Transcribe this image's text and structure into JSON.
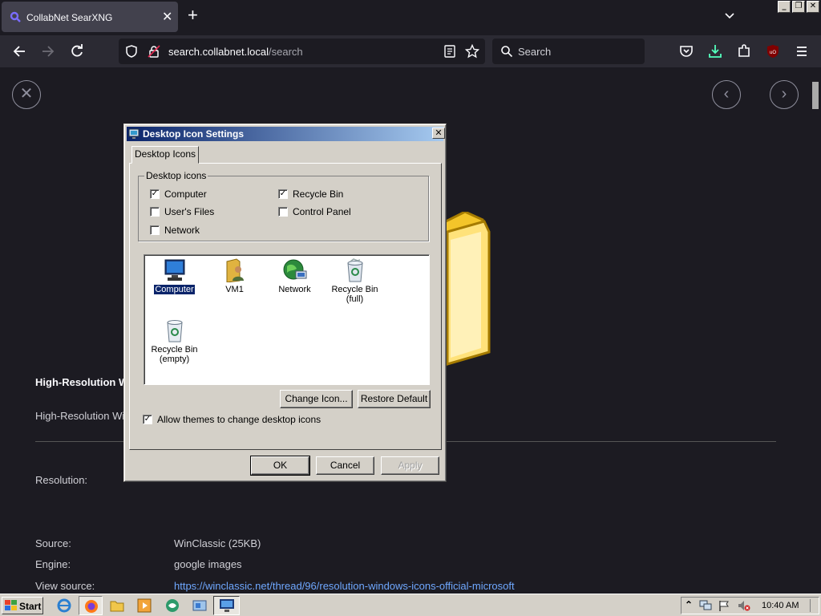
{
  "browser": {
    "tab_title": "CollabNet SearXNG",
    "url_domain": "search.collabnet.local",
    "url_path": "/search",
    "search_placeholder": "Search",
    "window_buttons": [
      "_",
      "❐",
      "✕"
    ]
  },
  "page": {
    "result_title": "High-Resolution W",
    "result_desc": "High-Resolution Wi",
    "fields": [
      {
        "key": "Resolution:",
        "value": ""
      },
      {
        "key": "Source:",
        "value": "WinClassic (25KB)"
      },
      {
        "key": "Engine:",
        "value": "google images"
      },
      {
        "key": "View source:",
        "value": "https://winclassic.net/thread/96/resolution-windows-icons-official-microsoft"
      }
    ]
  },
  "dialog": {
    "title": "Desktop Icon Settings",
    "tab": "Desktop Icons",
    "group_label": "Desktop icons",
    "checkboxes": [
      {
        "label": "Computer",
        "checked": true
      },
      {
        "label": "User's Files",
        "checked": false
      },
      {
        "label": "Network",
        "checked": false
      },
      {
        "label": "Recycle Bin",
        "checked": true
      },
      {
        "label": "Control Panel",
        "checked": false
      }
    ],
    "icons": [
      {
        "label": "Computer",
        "icon": "computer-icon",
        "selected": true
      },
      {
        "label": "VM1",
        "icon": "user-folder-icon"
      },
      {
        "label": "Network",
        "icon": "network-globe-icon"
      },
      {
        "label": "Recycle Bin (full)",
        "icon": "recycle-bin-full-icon"
      },
      {
        "label": "Recycle Bin (empty)",
        "icon": "recycle-bin-empty-icon"
      }
    ],
    "change_icon": "Change Icon...",
    "restore_default": "Restore Default",
    "allow_themes": "Allow themes to change desktop icons",
    "allow_themes_checked": true,
    "ok": "OK",
    "cancel": "Cancel",
    "apply": "Apply"
  },
  "taskbar": {
    "start": "Start",
    "clock": "10:40 AM"
  },
  "colors": {
    "accent": "#0a246a",
    "browser_bg": "#1c1b22",
    "classic_face": "#d4d0c8"
  }
}
